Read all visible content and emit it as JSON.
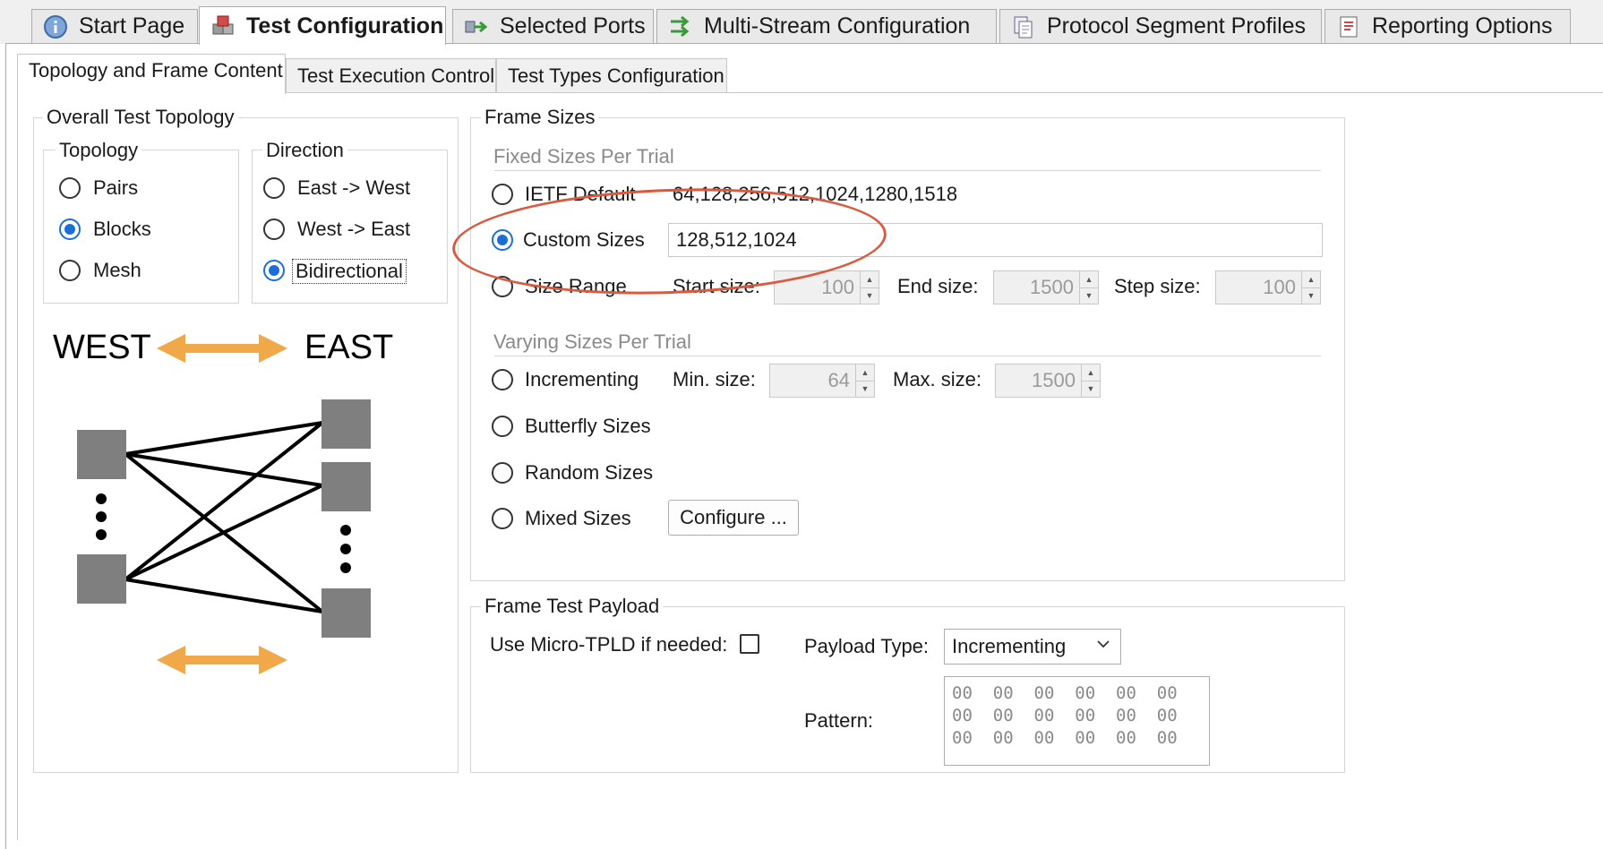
{
  "top_tabs": [
    {
      "label": "Start Page",
      "icon": "info-icon",
      "active": false
    },
    {
      "label": "Test Configuration",
      "icon": "cubes-icon",
      "active": true
    },
    {
      "label": "Selected Ports",
      "icon": "ports-icon",
      "active": false
    },
    {
      "label": "Multi-Stream Configuration",
      "icon": "multi-stream-icon",
      "active": false
    },
    {
      "label": "Protocol Segment Profiles",
      "icon": "pages-icon",
      "active": false
    },
    {
      "label": "Reporting Options",
      "icon": "report-icon",
      "active": false
    }
  ],
  "sub_tabs": [
    {
      "label": "Topology and Frame Content",
      "active": true
    },
    {
      "label": "Test Execution Control",
      "active": false
    },
    {
      "label": "Test Types Configuration",
      "active": false
    }
  ],
  "topology_group": {
    "title": "Overall Test Topology",
    "topology": {
      "title": "Topology",
      "options": [
        "Pairs",
        "Blocks",
        "Mesh"
      ],
      "selected": "Blocks"
    },
    "direction": {
      "title": "Direction",
      "options": [
        "East -> West",
        "West -> East",
        "Bidirectional"
      ],
      "selected": "Bidirectional"
    },
    "diagram": {
      "west_label": "WEST",
      "east_label": "EAST",
      "arrow_color": "#f0a848",
      "node_color": "#7f7f7f"
    }
  },
  "frame_sizes": {
    "title": "Frame Sizes",
    "fixed_title": "Fixed Sizes Per Trial",
    "ietf_label": "IETF Default",
    "ietf_value": "64,128,256,512,1024,1280,1518",
    "custom_label": "Custom Sizes",
    "custom_value": "128,512,1024",
    "range_label": "Size Range",
    "start_label": "Start size:",
    "start_value": "100",
    "end_label": "End size:",
    "end_value": "1500",
    "step_label": "Step size:",
    "step_value": "100",
    "varying_title": "Varying Sizes Per Trial",
    "incrementing_label": "Incrementing",
    "min_label": "Min. size:",
    "min_value": "64",
    "max_label": "Max. size:",
    "max_value": "1500",
    "butterfly_label": "Butterfly Sizes",
    "random_label": "Random Sizes",
    "mixed_label": "Mixed Sizes",
    "configure_label": "Configure ...",
    "selected": "Custom Sizes",
    "highlight_color": "#d95a3e"
  },
  "payload": {
    "title": "Frame Test Payload",
    "micro_tpld_label": "Use Micro-TPLD if needed:",
    "micro_tpld_checked": false,
    "payload_type_label": "Payload Type:",
    "payload_type_value": "Incrementing",
    "pattern_label": "Pattern:",
    "pattern_rows": [
      "00  00  00  00  00  00",
      "00  00  00  00  00  00",
      "00  00  00  00  00  00"
    ]
  }
}
